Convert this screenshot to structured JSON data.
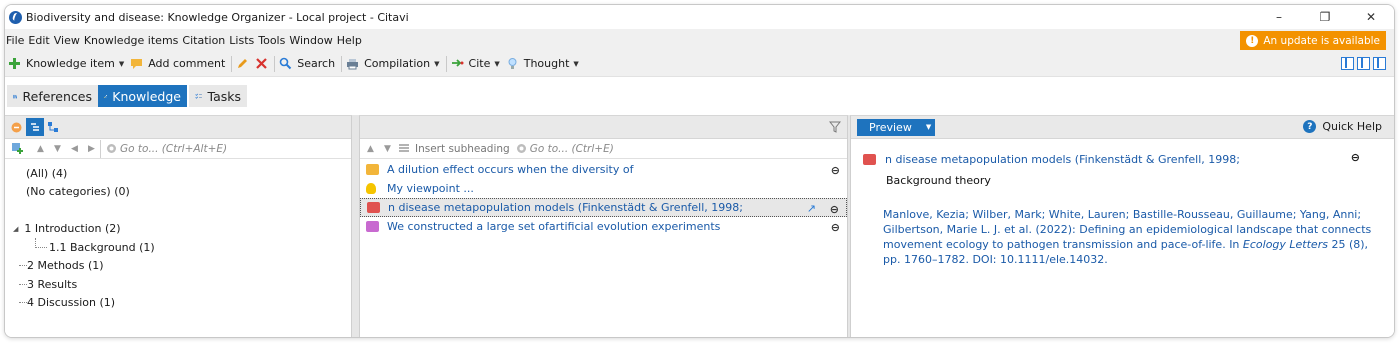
{
  "window": {
    "title": "Biodiversity and disease: Knowledge Organizer - Local project - Citavi",
    "controls": [
      "–",
      "❐",
      "✕"
    ]
  },
  "menu": [
    "File",
    "Edit",
    "View",
    "Knowledge items",
    "Citation",
    "Lists",
    "Tools",
    "Window",
    "Help"
  ],
  "update_notice": "An update is available",
  "toolbar": {
    "knowledge_item": "Knowledge item",
    "add_comment": "Add comment",
    "search": "Search",
    "compilation": "Compilation",
    "cite": "Cite",
    "thought": "Thought"
  },
  "tabs": [
    {
      "label": "References",
      "active": false
    },
    {
      "label": "Knowledge",
      "active": true
    },
    {
      "label": "Tasks",
      "active": false
    }
  ],
  "categories": {
    "goto_placeholder": "Go to... (Ctrl+Alt+E)",
    "items": [
      {
        "label": "(All) (4)",
        "selected": true
      },
      {
        "label": "(No categories) (0)"
      },
      {
        "label": ""
      },
      {
        "label": "1 Introduction (2)"
      },
      {
        "label": "1.1 Background (1)"
      },
      {
        "label": "2 Methods (1)"
      },
      {
        "label": "3 Results"
      },
      {
        "label": "4 Discussion (1)"
      }
    ]
  },
  "knowledge_items": {
    "insert_subheading": "Insert subheading",
    "goto_placeholder": "Go to... (Ctrl+E)",
    "items": [
      {
        "text": "A dilution effect occurs when the diversity of",
        "icon": "comment-icon",
        "color": "#f2b53a",
        "linked": true
      },
      {
        "text": "My viewpoint ...",
        "icon": "thought-icon",
        "color": "#f5c400",
        "linked": false
      },
      {
        "text": "n disease metapopulation models (Finkenstädt & Grenfell, 1998;",
        "icon": "quotation-icon",
        "color": "#e0524f",
        "linked": true,
        "selected": true
      },
      {
        "text": "We constructed a large set ofartificial evolution experiments",
        "icon": "summary-icon",
        "color": "#c86ad0",
        "linked": true
      }
    ]
  },
  "preview": {
    "button": "Preview",
    "quick_help": "Quick Help",
    "item_title": "n disease metapopulation models (Finkenstädt & Grenfell, 1998;",
    "category": "Background theory",
    "reference_pre": "Manlove, Kezia; Wilber, Mark; White, Lauren; Bastille-Rousseau, Guillaume; Yang, Anni; Gilbertson, Marie L. J. et al. (2022): Defining an epidemiological landscape that connects movement ecology to pathogen transmission and pace-of-life. In ",
    "reference_journal": "Ecology Letters",
    "reference_post": " 25 (8), pp. 1760–1782. DOI: 10.1111/ele.14032."
  },
  "colors": {
    "accent": "#1e73be",
    "update": "#f39200"
  }
}
